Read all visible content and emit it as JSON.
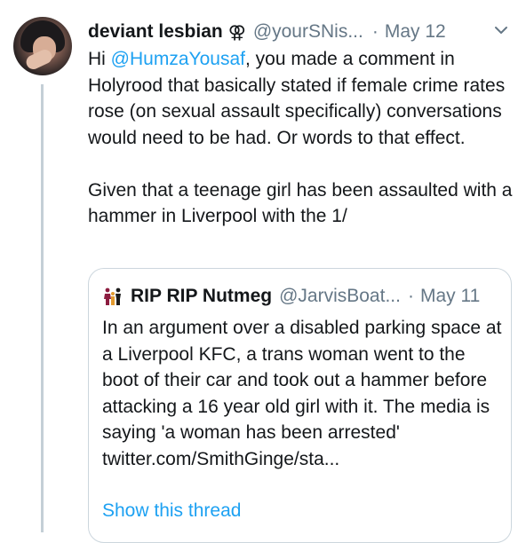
{
  "tweet": {
    "author_name": "deviant lesbian",
    "author_symbol": "⚢",
    "author_handle": "@yourSNis...",
    "separator": "·",
    "date": "May 12",
    "text_prefix": "Hi ",
    "mention": "@HumzaYousaf",
    "text_p1_rest": ", you made a comment in Holyrood that basically stated if female crime rates rose (on sexual assault specifically) conversations would need to be had. Or words to that effect.",
    "text_p2": "Given that a teenage girl has been assaulted with a hammer in Liverpool with the 1/",
    "menu_icon": "chevron-down-icon",
    "avatar_icon": "avatar"
  },
  "quoted_tweet": {
    "author_name": "RIP RIP Nutmeg",
    "author_handle": "@JarvisBoat...",
    "separator": "·",
    "date": "May 11",
    "text": "In an argument over a disabled parking space at a Liverpool KFC, a trans woman went to the boot of their car and took out a hammer before attacking a 16 year old girl with it. The media is saying 'a woman has been arrested'",
    "link": "twitter.com/SmithGinge/sta...",
    "show_thread": "Show this thread",
    "avatar_icon": "family-icon"
  },
  "colors": {
    "link": "#1da1f2",
    "secondary": "#657786",
    "border": "#ccd6dd",
    "thread_line": "#c4cfd6"
  }
}
